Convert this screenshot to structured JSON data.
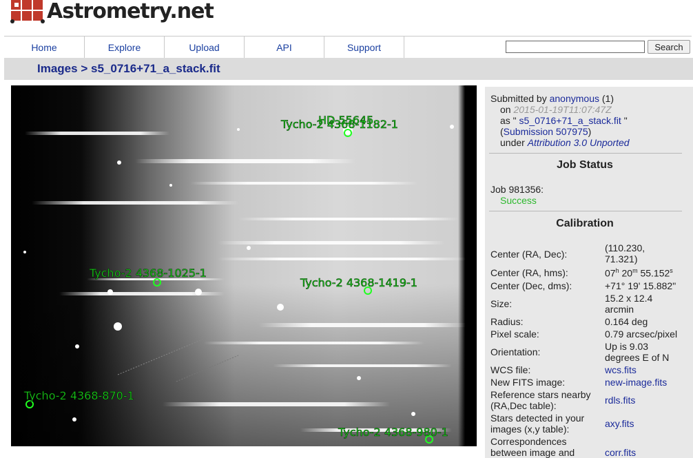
{
  "logo": {
    "text": "Astrometry.net"
  },
  "nav": {
    "items": [
      "Home",
      "Explore",
      "Upload",
      "API",
      "Support"
    ],
    "search_value": "",
    "search_button": "Search"
  },
  "breadcrumb": {
    "parent": "Images",
    "sep": ">",
    "current": "s5_0716+71_a_stack.fit"
  },
  "image": {
    "annotations": [
      "Tycho-2 4368-1182-1",
      "HD 55645",
      "Tycho-2 4368-1025-1",
      "Tycho-2 4368-1419-1",
      "Tycho-2 4368-870-1",
      "Tycho-2 4368-980-1"
    ]
  },
  "submission": {
    "submitted_by_label": "Submitted by",
    "user": "anonymous",
    "user_count": "(1)",
    "on_label": "on",
    "date": "2015-01-19T11:07:47Z",
    "as_label": "as \"",
    "filename": "s5_0716+71_a_stack.fit",
    "as_close": "\"",
    "sub_open": "(",
    "submission_link": "Submission 507975",
    "sub_close": ")",
    "under_label": "under",
    "license": "Attribution 3.0 Unported"
  },
  "job_status": {
    "title": "Job Status",
    "job_label": "Job 981356:",
    "status": "Success",
    "status_color": "#2db82d"
  },
  "calibration": {
    "title": "Calibration",
    "center_radec_label": "Center (RA, Dec):",
    "center_radec_1": "(110.230,",
    "center_radec_2": "71.321)",
    "center_hms_label": "Center (RA, hms):",
    "hms_h": "07",
    "hms_m": "20",
    "hms_s": "55.152",
    "unit_h": "h",
    "unit_m": "m",
    "unit_s": "s",
    "center_dms_label": "Center (Dec, dms):",
    "center_dms": "+71° 19' 15.882\"",
    "size_label": "Size:",
    "size_1": "15.2 x 12.4",
    "size_2": "arcmin",
    "radius_label": "Radius:",
    "radius": "0.164 deg",
    "pixscale_label": "Pixel scale:",
    "pixscale": "0.79 arcsec/pixel",
    "orient_label": "Orientation:",
    "orient_1": "Up is 9.03",
    "orient_2": "degrees E of N",
    "wcs_label": "WCS file:",
    "wcs": "wcs.fits",
    "newfits_label": "New FITS image:",
    "newfits": "new-image.fits",
    "refstars_label_1": "Reference stars nearby",
    "refstars_label_2": "(RA,Dec table):",
    "refstars": "rdls.fits",
    "detected_label_1": "Stars detected in your",
    "detected_label_2": "images (x,y table):",
    "detected": "axy.fits",
    "corr_label_1": "Correspondences",
    "corr_label_2": "between image and",
    "corr": "corr.fits"
  }
}
